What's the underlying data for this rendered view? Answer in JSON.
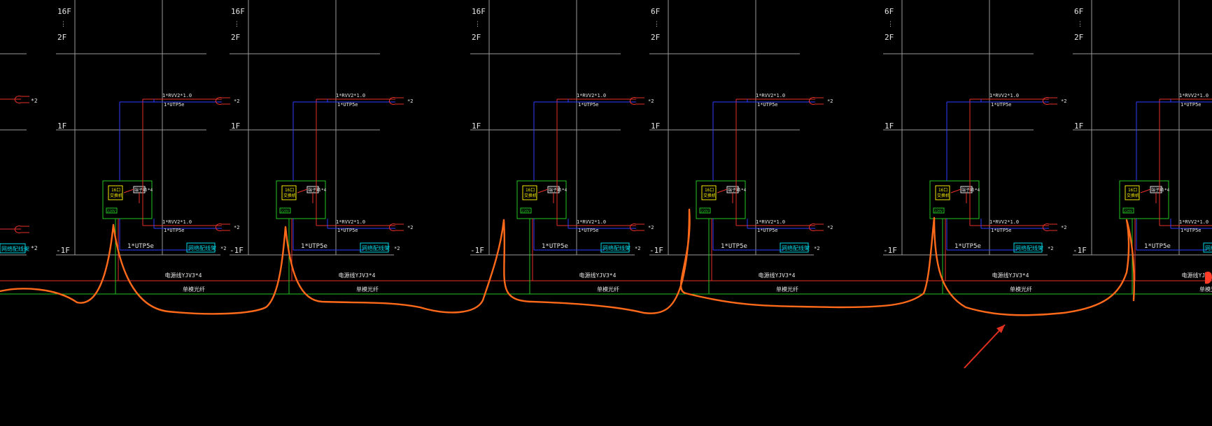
{
  "colors": {
    "background": "#000000",
    "grid": "#9a9a9a",
    "red_wire": "#e8312a",
    "blue_wire": "#2f3cff",
    "green": "#22c422",
    "yellow": "#f2e600",
    "cyan": "#00d8e8",
    "white_text": "#e6e6e6",
    "markup": "#ff6a1a"
  },
  "icons": [
    "outlet-symbol-icon",
    "switch-box-icon",
    "terminal-box-icon",
    "arrow-annotation-icon"
  ],
  "floors": {
    "top_high_16": "16F",
    "top_high_6": "6F",
    "dot": "⋮",
    "top_low": "2F",
    "mid": "1F",
    "base": "-1F"
  },
  "labels": {
    "rvv_cable": "1*RVV2*1.0",
    "utp_cable": "1*UTP5e",
    "utp_main": "1*UTP5e",
    "times_two": "*2",
    "switch_box_line1": "16口",
    "switch_box_line2": "交换机",
    "terminal_box": "端子箱",
    "power_tag": "220V",
    "network_panel": "网络配线架",
    "power_cable": "电源线YJV3*4",
    "fiber_cable": "单模光纤"
  },
  "sections": [
    {
      "top_floor": "16F",
      "bottom_floor": "2F"
    },
    {
      "top_floor": "16F",
      "bottom_floor": "2F"
    },
    {
      "top_floor": "16F",
      "bottom_floor": "2F"
    },
    {
      "top_floor": "6F",
      "bottom_floor": "2F"
    },
    {
      "top_floor": "6F",
      "bottom_floor": "2F"
    },
    {
      "top_floor": "6F",
      "bottom_floor": "2F"
    }
  ]
}
